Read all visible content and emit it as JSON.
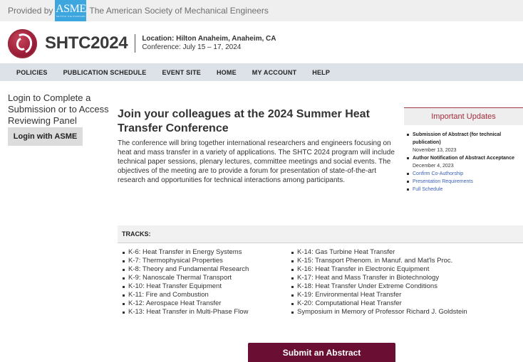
{
  "provided": {
    "prefix": "Provided by",
    "logo_text": "ASME",
    "logo_subtext": "SETTING THE STANDARD",
    "org_name": "The American Society of Mechanical Engineers"
  },
  "brand": {
    "title": "SHTC2024",
    "location": "Location: Hilton Anaheim, Anaheim, CA",
    "dates": "Conference: July 15 – 17, 2024"
  },
  "nav": {
    "items": [
      "POLICIES",
      "PUBLICATION SCHEDULE",
      "EVENT SITE",
      "HOME",
      "MY ACCOUNT",
      "HELP"
    ]
  },
  "login": {
    "prompt": "Login to Complete a Submission or to Access Reviewing Panel",
    "button": "Login with ASME"
  },
  "main": {
    "heading": "Join your colleagues at the 2024 Summer Heat Transfer Conference",
    "body": "The conference will bring together international researchers and engineers focusing on heat and mass transfer in a variety of applications. The SHTC 2024 program will include technical paper sessions, plenary lectures, committee meetings and social events. The objectives of the meeting are to provide a forum for presentation of state-of-the-art research and opportunities for technical interactions among participants."
  },
  "updates": {
    "title": "Important Updates",
    "items": [
      {
        "label": "Submission of Abstract (for technical publication)",
        "date": "November 13, 2023"
      },
      {
        "label": "Author Notification of Abstract Acceptance",
        "date": "December 4, 2023"
      }
    ],
    "links": [
      "Confirm Co-Authorship",
      "Presentation Requirements",
      "Full Schedule"
    ]
  },
  "tracks": {
    "title": "TRACKS:",
    "left": [
      "K-6: Heat Transfer in Energy Systems",
      "K-7: Thermophysical Properties",
      "K-8: Theory and Fundamental Research",
      "K-9: Nanoscale Thermal Transport",
      "K-10: Heat Transfer Equipment",
      "K-11: Fire and Combustion",
      "K-12: Aerospace Heat Transfer",
      "K-13: Heat Transfer in Multi-Phase Flow"
    ],
    "right": [
      "K-14: Gas Turbine Heat Transfer",
      "K-15: Transport Phenom. in Manuf. and Mat'ls Proc.",
      "K-16: Heat Transfer in Electronic Equipment",
      "K-17: Heat and Mass Transfer in Biotechnology",
      "K-18: Heat Transfer Under Extreme Conditions",
      "K-19: Environmental Heat Transfer",
      "K-20: Computational Heat Transfer",
      "Symposium in Memory of Professor Richard J. Goldstein"
    ]
  },
  "submit": {
    "label": "Submit an Abstract"
  },
  "colors": {
    "accent": "#6a0f33",
    "updates_title": "#a22c3c",
    "asme_blue": "#3ea6df",
    "nav_bg": "#dde2e8",
    "link": "#3a5fb8"
  }
}
